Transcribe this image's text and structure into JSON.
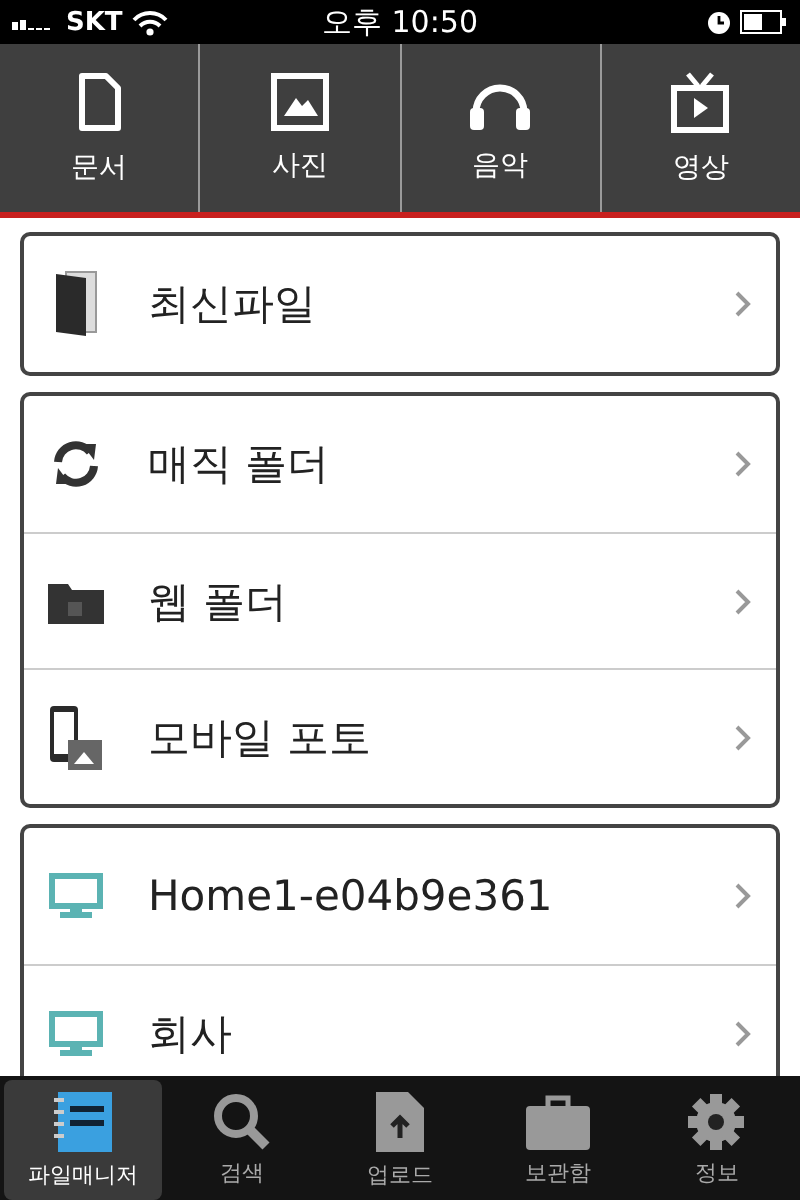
{
  "status_bar": {
    "carrier": "SKT",
    "time": "오후 10:50"
  },
  "categories": [
    {
      "label": "문서",
      "kind": "document"
    },
    {
      "label": "사진",
      "kind": "photo"
    },
    {
      "label": "음악",
      "kind": "music"
    },
    {
      "label": "영상",
      "kind": "video"
    }
  ],
  "groups": [
    [
      {
        "label": "최신파일",
        "kind": "recent"
      }
    ],
    [
      {
        "label": "매직 폴더",
        "kind": "sync"
      },
      {
        "label": "웹 폴더",
        "kind": "webfolder"
      },
      {
        "label": "모바일 포토",
        "kind": "mobile"
      }
    ],
    [
      {
        "label": "Home1-e04b9e361",
        "kind": "computer"
      },
      {
        "label": "회사",
        "kind": "computer"
      }
    ]
  ],
  "tab_bar": [
    {
      "label": "파일매니저",
      "kind": "notebook",
      "selected": true
    },
    {
      "label": "검색",
      "kind": "search",
      "selected": false
    },
    {
      "label": "업로드",
      "kind": "upload",
      "selected": false
    },
    {
      "label": "보관함",
      "kind": "briefcase",
      "selected": false
    },
    {
      "label": "정보",
      "kind": "settings",
      "selected": false
    }
  ]
}
